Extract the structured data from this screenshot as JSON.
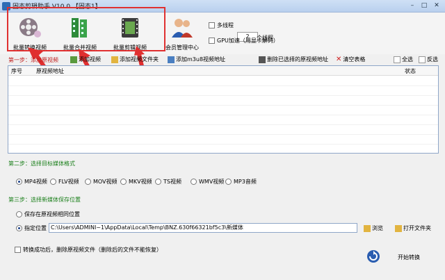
{
  "window": {
    "title": "固态剪辑助手 V10.0  【固态1】",
    "controls": [
      "–",
      "□",
      "✕"
    ]
  },
  "toolbar": {
    "batch_convert": "批量转换视频",
    "batch_merge": "批量合并视频",
    "batch_cut": "批量剪辑视频",
    "member_center": "会员管理中心",
    "multithread_label": "多线程",
    "threads_value": "2",
    "threads_suffix": "个线程",
    "gpu_label": "GPU加速（用显卡解码）"
  },
  "step1": {
    "label": "第一步：添加原视频",
    "add_video": "添加视频",
    "add_folder": "添加视频文件夹",
    "add_m3u8": "添加m3u8视频地址",
    "delete_selected": "删除已选择的原视频地址",
    "clear_table": "清空表格",
    "select_all": "全选",
    "invert": "反选"
  },
  "table": {
    "col_index": "序号",
    "col_path": "原视频地址",
    "col_status": "状态"
  },
  "step2": {
    "label": "第二步：选择目标媒体格式",
    "formats": [
      "MP4视频",
      "FLV视频",
      "MOV视频",
      "MKV视频",
      "TS视频",
      "WMV视频",
      "MP3音频"
    ],
    "selected": "MP4视频"
  },
  "step3": {
    "label": "第三步：选择新媒体保存位置",
    "save_original": "保存在原视频相同位置",
    "specify": "指定位置",
    "path": "C:\\Users\\ADMINI~1\\AppData\\Local\\Temp\\BNZ.630f66321bf5c3\\新媒体",
    "browse": "浏览",
    "open_folder": "打开文件夹"
  },
  "footer": {
    "delete_after": "转换成功后，删除原视频文件（删除后的文件不能恢复）",
    "start": "开始转换"
  },
  "colors": {
    "highlight_red": "#e03030",
    "step_green": "#1a7f1a"
  }
}
